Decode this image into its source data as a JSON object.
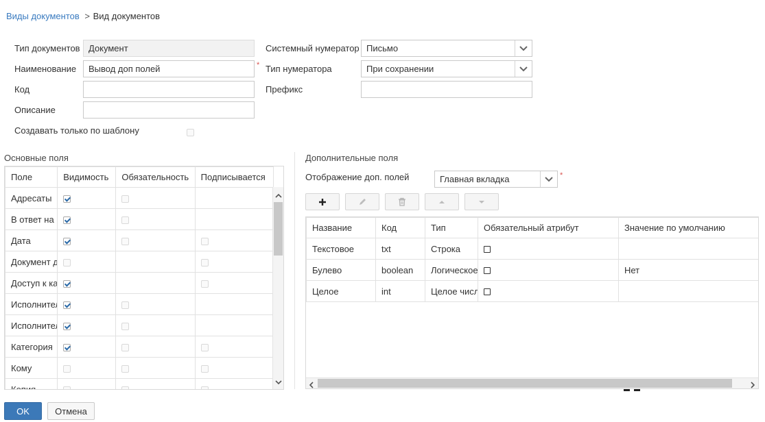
{
  "breadcrumb": {
    "link": "Виды документов",
    "separator": ">",
    "current": "Вид документов"
  },
  "form": {
    "type_label": "Тип документов",
    "type_value": "Документ",
    "name_label": "Наименование",
    "name_value": "Вывод доп полей",
    "code_label": "Код",
    "code_value": "",
    "desc_label": "Описание",
    "desc_value": "",
    "template_only_label": "Создавать только по шаблону",
    "sys_num_label": "Системный нумератор",
    "sys_num_value": "Письмо",
    "num_type_label": "Тип нумератора",
    "num_type_value": "При сохранении",
    "prefix_label": "Префикс",
    "prefix_value": "",
    "required_mark": "*"
  },
  "main_fields": {
    "title": "Основные поля",
    "columns": [
      "Поле",
      "Видимость",
      "Обязательность",
      "Подписывается"
    ],
    "rows": [
      {
        "field": "Адресаты",
        "visible": true,
        "required": false,
        "signed": null
      },
      {
        "field": "В ответ на",
        "visible": true,
        "required": false,
        "signed": null
      },
      {
        "field": "Дата",
        "visible": true,
        "required": false,
        "signed": false
      },
      {
        "field": "Документ д",
        "visible": false,
        "required": null,
        "signed": false
      },
      {
        "field": "Доступ к ка",
        "visible": true,
        "required": null,
        "signed": false
      },
      {
        "field": "Исполнител",
        "visible": true,
        "required": false,
        "signed": null
      },
      {
        "field": "Исполнител",
        "visible": true,
        "required": false,
        "signed": null
      },
      {
        "field": "Категория",
        "visible": true,
        "required": false,
        "signed": false
      },
      {
        "field": "Кому",
        "visible": false,
        "required": false,
        "signed": false
      },
      {
        "field": "Копия",
        "visible": false,
        "required": false,
        "signed": false
      }
    ]
  },
  "extra_fields": {
    "title": "Дополнительные поля",
    "display_label": "Отображение доп. полей",
    "display_value": "Главная вкладка",
    "columns": [
      "Название",
      "Код",
      "Тип",
      "Обязательный атрибут",
      "Значение по умолчанию"
    ],
    "rows": [
      {
        "name": "Текстовое",
        "code": "txt",
        "type": "Строка",
        "required": false,
        "default": ""
      },
      {
        "name": "Булево",
        "code": "boolean",
        "type": "Логическое",
        "required": false,
        "default": "Нет"
      },
      {
        "name": "Целое",
        "code": "int",
        "type": "Целое числ",
        "required": false,
        "default": ""
      }
    ]
  },
  "actions": {
    "ok": "OK",
    "cancel": "Отмена"
  },
  "colors": {
    "link": "#3a7bc0",
    "primary": "#3c79b8",
    "required": "#d9534f"
  }
}
